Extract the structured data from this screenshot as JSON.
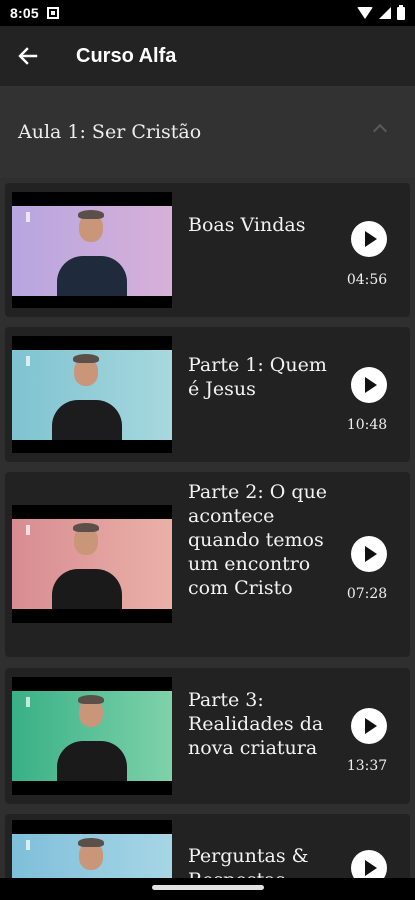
{
  "status_bar": {
    "time": "8:05"
  },
  "app_bar": {
    "title": "Curso Alfa"
  },
  "section": {
    "title": "Aula 1: Ser Cristão"
  },
  "videos": [
    {
      "title": "Boas Vindas",
      "duration": "04:56"
    },
    {
      "title": "Parte 1: Quem é Jesus",
      "duration": "10:48"
    },
    {
      "title": "Parte 2: O que acontece quando temos um encontro com Cristo",
      "duration": "07:28"
    },
    {
      "title": "Parte 3: Realidades da nova criatura",
      "duration": "13:37"
    },
    {
      "title": "Perguntas & Respostas",
      "duration": ""
    }
  ],
  "colors": {
    "background": "#000000",
    "app_bar": "#232323",
    "section_header": "#323232",
    "card": "#222222",
    "thumb_bg_1": "#c7a6d8",
    "thumb_bg_2": "#8ecad6",
    "thumb_bg_3": "#e19a99",
    "thumb_bg_4": "#3fb58d",
    "thumb_bg_5": "#8ec3db"
  }
}
